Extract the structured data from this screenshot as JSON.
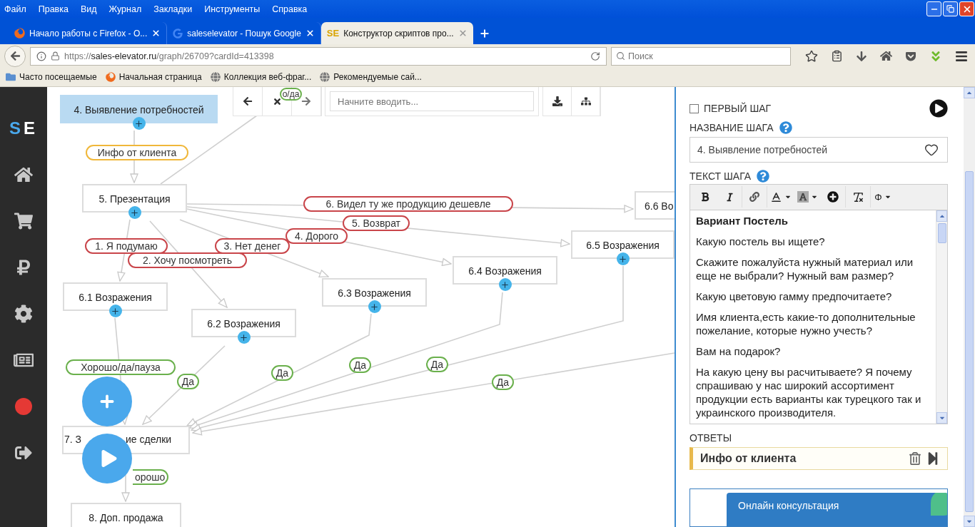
{
  "browser": {
    "menu": [
      "Файл",
      "Правка",
      "Вид",
      "Журнал",
      "Закладки",
      "Инструменты",
      "Справка"
    ],
    "tabs": [
      {
        "title": "Начало работы с Firefox - О...",
        "selected": false,
        "kind": "firefox"
      },
      {
        "title": "saleselevator - Пошук Google",
        "selected": false,
        "kind": "google"
      },
      {
        "title": "Конструктор скриптов про...",
        "selected": true,
        "kind": "site",
        "favicon": "SE"
      }
    ],
    "url": {
      "scheme": "https://",
      "domain": "sales-elevator.ru",
      "path": "/graph/26709?cardId=413398"
    },
    "search_placeholder": "Поиск",
    "bookmarks": [
      {
        "title": "Часто посещаемые",
        "kind": "folder"
      },
      {
        "title": "Начальная страница",
        "kind": "firefox"
      },
      {
        "title": "Коллекция веб-фраг...",
        "kind": "globe"
      },
      {
        "title": "Рекомендуемые сай...",
        "kind": "globe"
      }
    ]
  },
  "sidebar": {
    "logo": {
      "first": "S",
      "second": "E"
    },
    "items": [
      {
        "kind": "home"
      },
      {
        "kind": "cart"
      },
      {
        "kind": "ruble"
      },
      {
        "kind": "settings"
      },
      {
        "kind": "news"
      },
      {
        "kind": "record"
      },
      {
        "kind": "logout"
      }
    ]
  },
  "canvas": {
    "toolbar": {
      "search_placeholder": "Начните вводить..."
    },
    "nodes": [
      {
        "label": "4. Выявление потребностей",
        "selected": true
      },
      {
        "label": "5. Презентация",
        "selected": false
      },
      {
        "label": "6.6 Во",
        "selected": false
      },
      {
        "label": "6.5 Возражения",
        "selected": false
      },
      {
        "label": "6.4 Возражения",
        "selected": false
      },
      {
        "label": "6.3 Возражения",
        "selected": false
      },
      {
        "label": "6.1 Возражения",
        "selected": false
      },
      {
        "label": "6.2 Возражения",
        "selected": false
      },
      {
        "label_parts": [
          "7. З",
          "ие сделки"
        ],
        "selected": false
      },
      {
        "label": "8. Доп. продажа",
        "selected": false
      }
    ],
    "edge_labels": [
      {
        "text": "о/да",
        "color": "#6ab04c"
      },
      {
        "text": "Инфо от клиента",
        "color": "#f0b73a"
      },
      {
        "text": "6. Видел ту же продукцию дешевле",
        "color": "#c9454a"
      },
      {
        "text": "5. Возврат",
        "color": "#c9454a"
      },
      {
        "text": "4. Дорого",
        "color": "#c9454a"
      },
      {
        "text": "1. Я подумаю",
        "color": "#c9454a"
      },
      {
        "text": "3. Нет денег",
        "color": "#c9454a"
      },
      {
        "text": "2. Хочу посмотреть",
        "color": "#c9454a"
      },
      {
        "text": "Хорошо/да/пауза",
        "color": "#6ab04c"
      },
      {
        "text": "Да",
        "color": "#6ab04c"
      },
      {
        "text": "Да",
        "color": "#6ab04c"
      },
      {
        "text": "Да",
        "color": "#6ab04c"
      },
      {
        "text": "Да",
        "color": "#6ab04c"
      },
      {
        "text": "Да",
        "color": "#6ab04c"
      },
      {
        "text": "орошо",
        "color": "#6ab04c"
      }
    ]
  },
  "panel": {
    "first_step": {
      "label": "ПЕРВЫЙ ШАГ",
      "checked": false
    },
    "name_label": "НАЗВАНИЕ ШАГА",
    "name_value": "4. Выявление потребностей",
    "text_label": "ТЕКСТ ШАГА",
    "special_char": "Φ",
    "paragraphs": [
      {
        "kind": "heading",
        "text": "Вариант Постель"
      },
      {
        "kind": "text",
        "text": "Какую постель вы ищете?"
      },
      {
        "kind": "text",
        "text": "Скажите пожалуйста нужный материал или еще не выбрали? Нужный вам размер?"
      },
      {
        "kind": "text",
        "text": "Какую цветовую гамму предпочитаете?"
      },
      {
        "kind": "text",
        "text": "Имя клиента,есть какие-то дополнительные пожелание, которые нужно учесть?"
      },
      {
        "kind": "text",
        "text": "Вам на подарок?"
      },
      {
        "kind": "text",
        "text": "На какую цену вы расчитываете? Я почему спрашиваю у нас широкий ассортимент продукции есть варианты как турецкого так и украинского производителя."
      }
    ],
    "answers_label": "ОТВЕТЫ",
    "answers": [
      {
        "text": "Инфо от клиента"
      }
    ],
    "chat": "Онлайн консультация"
  }
}
